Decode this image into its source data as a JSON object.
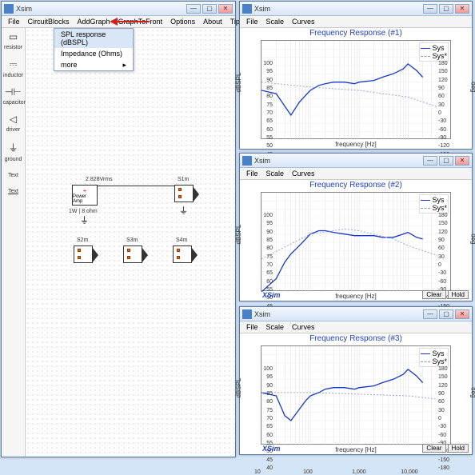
{
  "main_window": {
    "title": "Xsim",
    "menus": [
      "File",
      "CircuitBlocks",
      "AddGraph",
      "GraphToFront",
      "Options",
      "About",
      "Tips!"
    ],
    "dropdown": {
      "items": [
        "SPL response (dBSPL)",
        "Impedance (Ohms)",
        "more"
      ]
    },
    "tools": [
      {
        "sym": "▭",
        "label": "resistor"
      },
      {
        "sym": "⎓",
        "label": "inductor"
      },
      {
        "sym": "⊣⊢",
        "label": "capacitor"
      },
      {
        "sym": "◁",
        "label": "driver"
      },
      {
        "sym": "⏚",
        "label": "ground"
      },
      {
        "sym": "T",
        "label": "Text"
      },
      {
        "sym": "T",
        "label": "Text"
      }
    ],
    "amp": {
      "label": "Power\nAmp",
      "volt": "2.828Vrms",
      "sub": "1W | 8 ohm"
    },
    "speakers": [
      "S1m",
      "S2m",
      "S3m",
      "S4m"
    ]
  },
  "graph_windows": [
    {
      "title": "Xsim",
      "chart_title": "Frequency Response (#1)"
    },
    {
      "title": "Xsim",
      "chart_title": "Frequency Response (#2)"
    },
    {
      "title": "Xsim",
      "chart_title": "Frequency Response (#3)"
    }
  ],
  "graph_common": {
    "menus": [
      "File",
      "Scale",
      "Curves"
    ],
    "ylabel": "dBSPL",
    "ylabel2": "deg",
    "xlabel": "frequency [Hz]",
    "logo": "XSim",
    "buttons": [
      "Clear",
      "Hold"
    ],
    "legend": [
      "Sys",
      "Sys*"
    ],
    "y_ticks": [
      "100",
      "95",
      "90",
      "85",
      "80",
      "75",
      "70",
      "65",
      "60",
      "55",
      "50",
      "45",
      "40"
    ],
    "y2_ticks": [
      "180",
      "150",
      "120",
      "90",
      "60",
      "30",
      "0",
      "-30",
      "-60",
      "-90",
      "-120",
      "-150",
      "-180"
    ],
    "x_ticks": [
      "10",
      "100",
      "1,000",
      "10,000"
    ]
  },
  "chart_data": [
    {
      "type": "line",
      "title": "Frequency Response (#1)",
      "xlabel": "frequency [Hz]",
      "ylabel": "dBSPL",
      "y2label": "deg",
      "xlim": [
        10,
        40000
      ],
      "ylim": [
        40,
        100
      ],
      "y2lim": [
        -180,
        180
      ],
      "xscale": "log",
      "series": [
        {
          "name": "Sys",
          "axis": "y",
          "x": [
            10,
            20,
            40,
            60,
            80,
            100,
            150,
            200,
            300,
            500,
            800,
            1000,
            2000,
            3000,
            5000,
            8000,
            10000,
            15000,
            20000
          ],
          "y": [
            70,
            68,
            55,
            63,
            67,
            70,
            73,
            74,
            75,
            75,
            74,
            75,
            76,
            78,
            80,
            83,
            86,
            82,
            78
          ]
        },
        {
          "name": "Sys*",
          "axis": "y2",
          "x": [
            10,
            100,
            1000,
            10000,
            40000
          ],
          "y": [
            75,
            72,
            70,
            66,
            60
          ]
        }
      ]
    },
    {
      "type": "line",
      "title": "Frequency Response (#2)",
      "xlabel": "frequency [Hz]",
      "ylabel": "dBSPL",
      "y2label": "deg",
      "xlim": [
        10,
        40000
      ],
      "ylim": [
        40,
        100
      ],
      "y2lim": [
        -180,
        180
      ],
      "xscale": "log",
      "series": [
        {
          "name": "Sys",
          "axis": "y",
          "x": [
            10,
            20,
            30,
            40,
            60,
            80,
            100,
            150,
            200,
            300,
            500,
            800,
            1000,
            2000,
            3000,
            5000,
            8000,
            10000,
            15000,
            20000
          ],
          "y": [
            40,
            48,
            58,
            63,
            68,
            72,
            75,
            77,
            77,
            76,
            75,
            74,
            74,
            74,
            73,
            73,
            75,
            76,
            73,
            72
          ]
        },
        {
          "name": "Sys*",
          "axis": "y2",
          "x": [
            10,
            100,
            500,
            1000,
            5000,
            10000,
            40000
          ],
          "y": [
            60,
            75,
            78,
            77,
            72,
            68,
            62
          ]
        }
      ]
    },
    {
      "type": "line",
      "title": "Frequency Response (#3)",
      "xlabel": "frequency [Hz]",
      "ylabel": "dBSPL",
      "y2label": "deg",
      "xlim": [
        10,
        40000
      ],
      "ylim": [
        40,
        100
      ],
      "y2lim": [
        -180,
        180
      ],
      "xscale": "log",
      "series": [
        {
          "name": "Sys",
          "axis": "y",
          "x": [
            10,
            20,
            30,
            40,
            60,
            80,
            100,
            150,
            200,
            300,
            500,
            800,
            1000,
            2000,
            3000,
            5000,
            8000,
            10000,
            15000,
            20000
          ],
          "y": [
            72,
            70,
            58,
            55,
            62,
            67,
            70,
            72,
            74,
            75,
            75,
            74,
            75,
            76,
            78,
            80,
            83,
            86,
            82,
            78
          ]
        },
        {
          "name": "Sys*",
          "axis": "y2",
          "x": [
            10,
            100,
            1000,
            10000,
            40000
          ],
          "y": [
            72,
            72,
            71,
            70,
            68
          ]
        }
      ]
    }
  ]
}
